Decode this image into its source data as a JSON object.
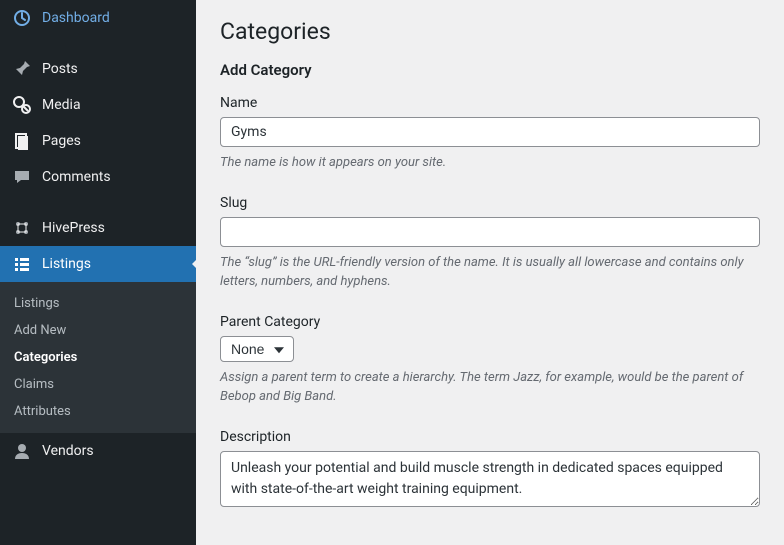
{
  "sidebar": {
    "dashboard": "Dashboard",
    "posts": "Posts",
    "media": "Media",
    "pages": "Pages",
    "comments": "Comments",
    "hivepress": "HivePress",
    "listings": "Listings",
    "vendors": "Vendors"
  },
  "submenu": {
    "listings": "Listings",
    "add_new": "Add New",
    "categories": "Categories",
    "claims": "Claims",
    "attributes": "Attributes"
  },
  "page": {
    "title": "Categories",
    "section": "Add Category"
  },
  "fields": {
    "name": {
      "label": "Name",
      "value": "Gyms",
      "help": "The name is how it appears on your site."
    },
    "slug": {
      "label": "Slug",
      "value": "",
      "help": "The “slug” is the URL-friendly version of the name. It is usually all lowercase and contains only letters, numbers, and hyphens."
    },
    "parent": {
      "label": "Parent Category",
      "selected": "None",
      "help": "Assign a parent term to create a hierarchy. The term Jazz, for example, would be the parent of Bebop and Big Band."
    },
    "description": {
      "label": "Description",
      "value": "Unleash your potential and build muscle strength in dedicated spaces equipped with state-of-the-art weight training equipment."
    }
  }
}
